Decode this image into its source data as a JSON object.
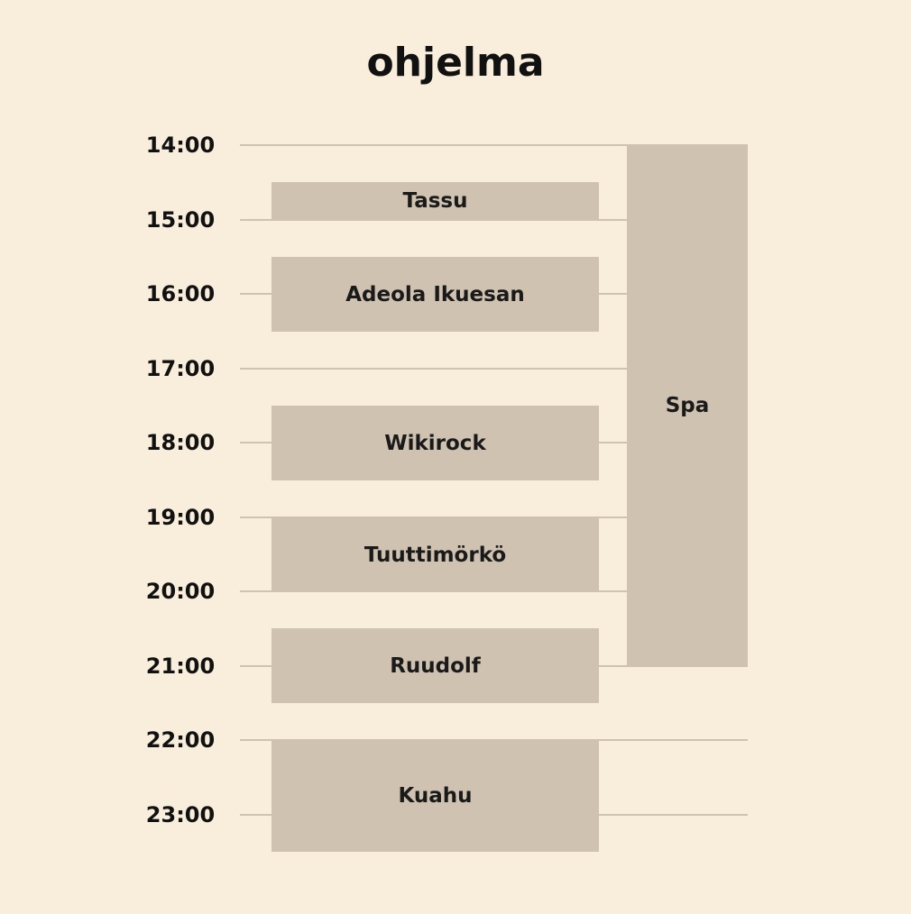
{
  "title": "ohjelma",
  "times": [
    "14:00",
    "15:00",
    "16:00",
    "17:00",
    "18:00",
    "19:00",
    "20:00",
    "21:00",
    "22:00",
    "23:00"
  ],
  "events": [
    {
      "name": "Tassu",
      "column": "main",
      "start_hour": 14.5,
      "end_hour": 15.0
    },
    {
      "name": "Adeola Ikuesan",
      "column": "main",
      "start_hour": 15.5,
      "end_hour": 16.5
    },
    {
      "name": "Wikirock",
      "column": "main",
      "start_hour": 17.5,
      "end_hour": 18.5
    },
    {
      "name": "Tuuttimörkö",
      "column": "main",
      "start_hour": 19.0,
      "end_hour": 20.0
    },
    {
      "name": "Ruudolf",
      "column": "main",
      "start_hour": 20.5,
      "end_hour": 21.5
    },
    {
      "name": "Kuahu",
      "column": "main",
      "start_hour": 22.0,
      "end_hour": 23.5
    },
    {
      "name": "Spa",
      "column": "side",
      "start_hour": 14.0,
      "end_hour": 21.0
    }
  ],
  "colors": {
    "background": "#f9eedb",
    "block": "#cfc2b0",
    "line": "#cfc2b0",
    "text": "#111111"
  }
}
